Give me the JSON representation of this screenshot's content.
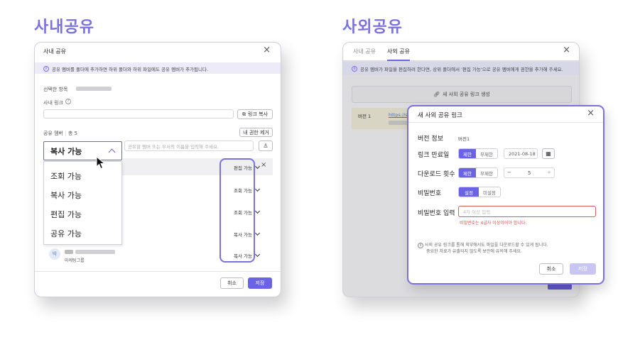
{
  "internal": {
    "heading": "사내공유",
    "dialog_title": "사내 공유",
    "notice": "공유 멤버를 폴더에 추가하면 하위 폴더와 하위 파일에도 공유 멤버가 추가됩니다.",
    "selected_item_label": "선택한 항목",
    "internal_link_label": "사내 링크",
    "copy_link_button": "링크 복사",
    "members_label": "공유 멤버",
    "members_count": "총 5",
    "remove_my_permission": "내 권한 제거",
    "search_placeholder": "공유할 멤버 또는 부서의 이름을 입력해 주세요.",
    "selected_permission": "복사 가능",
    "dropdown_options": [
      "조회 가능",
      "복사 가능",
      "편집 가능",
      "공유 가능"
    ],
    "member_permissions": [
      "편집 가능",
      "조회 가능",
      "조회 가능",
      "복사 가능",
      "복사 가능"
    ],
    "member_avatar": "박",
    "member_dept": "마케팅그룹",
    "cancel": "취소",
    "save": "저장"
  },
  "external": {
    "heading": "사외공유",
    "tabs": [
      "사내 공유",
      "사외 공유"
    ],
    "notice": "공유 멤버가 파일을 편집하려 한다면, 상위 폴더에서 '편집 가능'으로 공유 멤버에게 권한을 추가해 주세요.",
    "create_link_button": "새 사외 공유 링크 생성",
    "row_version": "버전 1",
    "row_link_prefix": "https://sl"
  },
  "modal": {
    "title": "새 사외 공유 링크",
    "version_label": "버전 정보",
    "version_value": "버전1",
    "expiry_label": "링크 만료일",
    "expiry_options": [
      "제한",
      "무제한"
    ],
    "expiry_date": "2021-08-18",
    "download_label": "다운로드 횟수",
    "download_options": [
      "제한",
      "무제한"
    ],
    "download_count": "5",
    "password_label": "비밀번호",
    "password_options": [
      "설정",
      "미설정"
    ],
    "password_input_label": "비밀번호 입력",
    "password_placeholder": "4자 이상 입력",
    "password_error": "비밀번호는 4글자 이상이어야 합니다.",
    "footnote_line1": "사외 공유 링크를 통해 외부에서도 파일을 다운로드할 수 있게 됩니다.",
    "footnote_line2": "중요한 자료가 유출되지 않도록 보안에 유의해 주세요.",
    "cancel": "취소",
    "save": "저장"
  }
}
